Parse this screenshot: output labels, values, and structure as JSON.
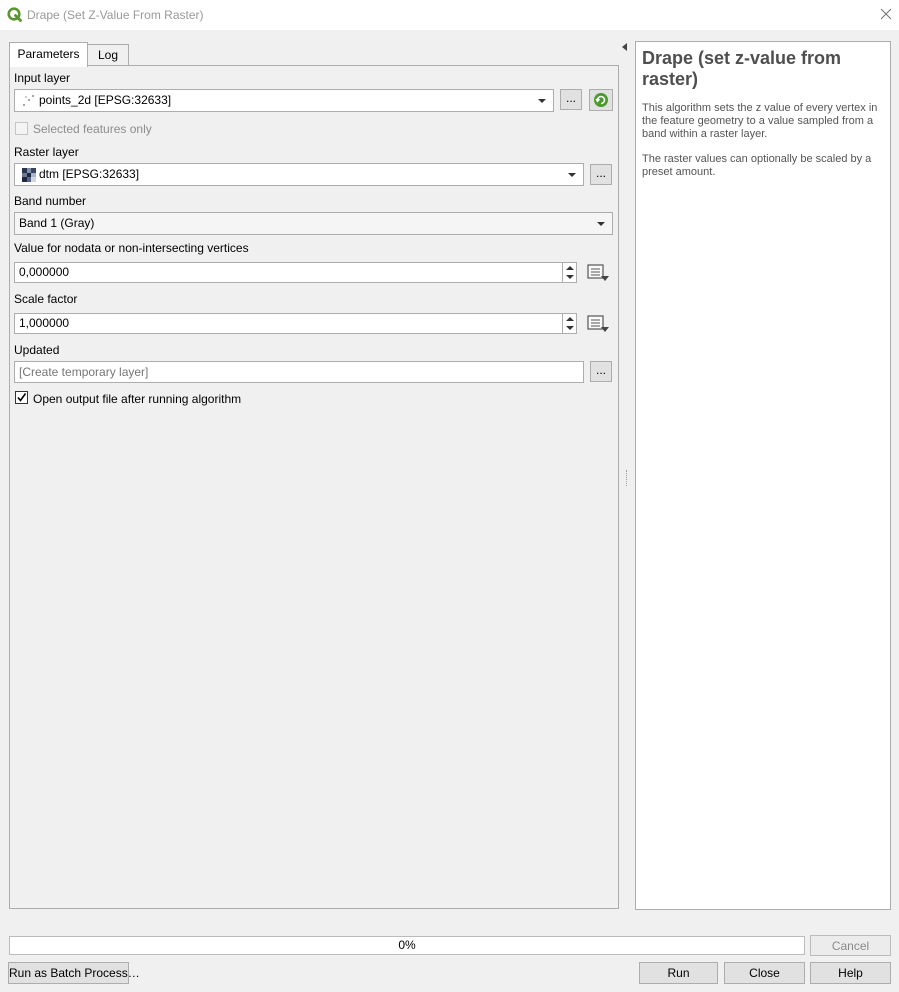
{
  "window": {
    "title": "Drape (Set Z-Value From Raster)"
  },
  "tabs": [
    {
      "label": "Parameters",
      "active": true
    },
    {
      "label": "Log",
      "active": false
    }
  ],
  "form": {
    "input_layer": {
      "label": "Input layer",
      "value": "points_2d [EPSG:32633]",
      "browse_label": "..."
    },
    "selected_features": {
      "label": "Selected features only",
      "checked": false,
      "enabled": false
    },
    "raster_layer": {
      "label": "Raster layer",
      "value": "dtm [EPSG:32633]",
      "browse_label": "..."
    },
    "band_number": {
      "label": "Band number",
      "value": "Band 1 (Gray)"
    },
    "nodata_value": {
      "label": "Value for nodata or non-intersecting vertices",
      "value": "0,000000"
    },
    "scale_factor": {
      "label": "Scale factor",
      "value": "1,000000"
    },
    "updated": {
      "label": "Updated",
      "placeholder": "[Create temporary layer]",
      "browse_label": "..."
    },
    "open_output": {
      "label": "Open output file after running algorithm",
      "checked": true
    }
  },
  "help": {
    "title": "Drape (set z-value from raster)",
    "paragraphs": [
      "This algorithm sets the z value of every vertex in the feature geometry to a value sampled from a band within a raster layer.",
      "The raster values can optionally be scaled by a preset amount."
    ]
  },
  "progress": {
    "text": "0%",
    "value": 0
  },
  "buttons": {
    "cancel": "Cancel",
    "batch": "Run as Batch Process…",
    "run": "Run",
    "close": "Close",
    "help": "Help"
  },
  "colors": {
    "qgis_green": "#589632",
    "panel_bg": "#f0f0f0",
    "help_title": "#4f4f4f"
  }
}
